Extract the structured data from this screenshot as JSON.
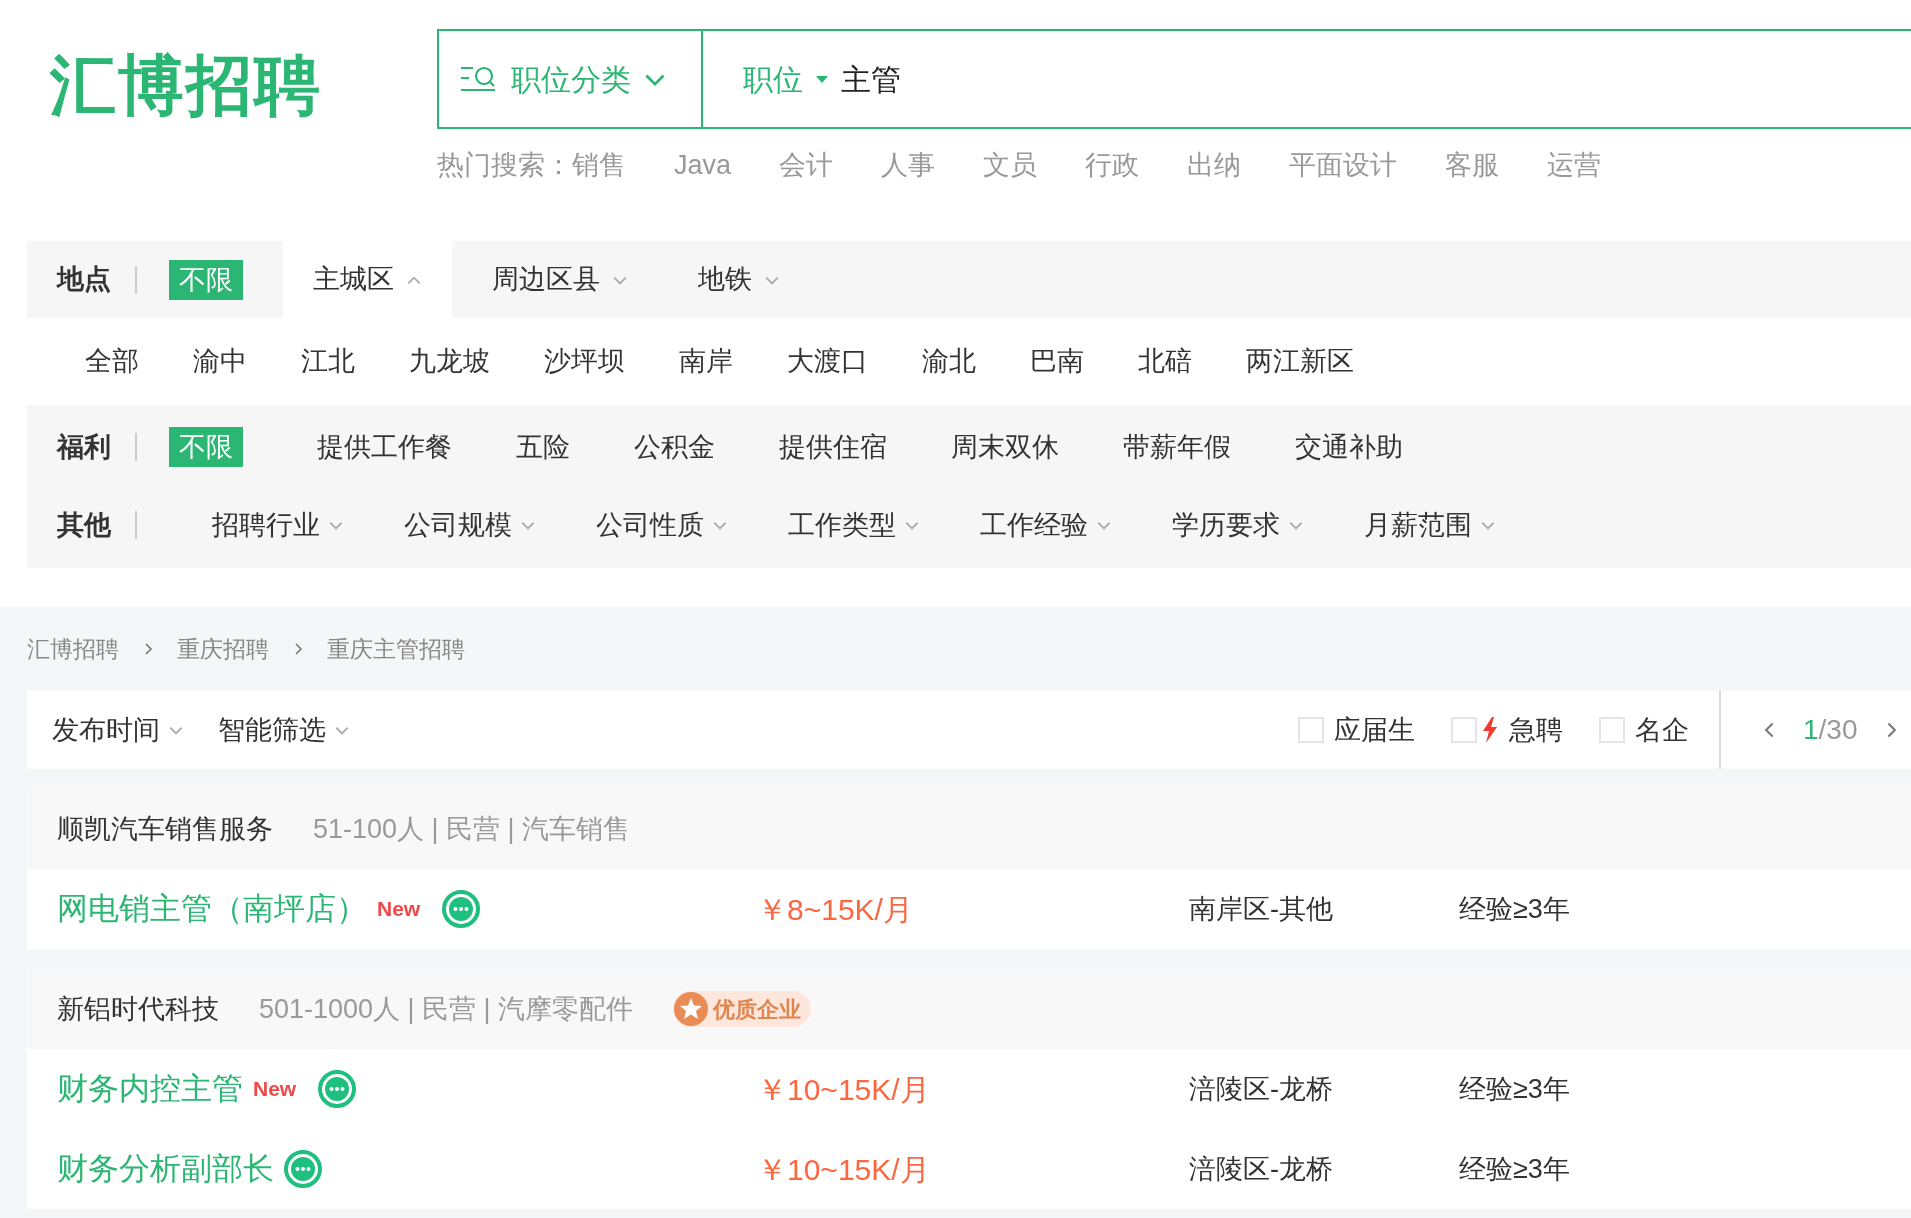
{
  "logo": "汇博招聘",
  "search": {
    "category": "职位分类",
    "field_type": "职位",
    "value": "主管"
  },
  "hot_search": {
    "label": "热门搜索：",
    "terms": [
      "销售",
      "Java",
      "会计",
      "人事",
      "文员",
      "行政",
      "出纳",
      "平面设计",
      "客服",
      "运营"
    ]
  },
  "filters": {
    "location": {
      "label": "地点",
      "options": [
        {
          "label": "不限",
          "selected": true
        }
      ],
      "tabs": [
        {
          "label": "主城区",
          "selected": true
        },
        {
          "label": "周边区县",
          "selected": false
        },
        {
          "label": "地铁",
          "selected": false
        }
      ],
      "districts": [
        {
          "label": "全部",
          "selected": false
        },
        {
          "label": "渝中",
          "selected": false
        },
        {
          "label": "江北",
          "selected": false
        },
        {
          "label": "九龙坡",
          "selected": false
        },
        {
          "label": "沙坪坝",
          "selected": false
        },
        {
          "label": "南岸",
          "selected": false
        },
        {
          "label": "大渡口",
          "selected": false
        },
        {
          "label": "渝北",
          "selected": false
        },
        {
          "label": "巴南",
          "selected": false
        },
        {
          "label": "北碚",
          "selected": false
        },
        {
          "label": "两江新区",
          "selected": false
        }
      ]
    },
    "welfare": {
      "label": "福利",
      "options": [
        {
          "label": "不限",
          "selected": true
        },
        {
          "label": "提供工作餐",
          "selected": false
        },
        {
          "label": "五险",
          "selected": false
        },
        {
          "label": "公积金",
          "selected": false
        },
        {
          "label": "提供住宿",
          "selected": false
        },
        {
          "label": "周末双休",
          "selected": false
        },
        {
          "label": "带薪年假",
          "selected": false
        },
        {
          "label": "交通补助",
          "selected": false
        }
      ]
    },
    "other": {
      "label": "其他",
      "dropdowns": [
        "招聘行业",
        "公司规模",
        "公司性质",
        "工作类型",
        "工作经验",
        "学历要求",
        "月薪范围"
      ]
    }
  },
  "breadcrumb": [
    "汇博招聘",
    "重庆招聘",
    "重庆主管招聘"
  ],
  "toolbar": {
    "sorts": [
      "发布时间",
      "智能筛选"
    ],
    "checks": [
      {
        "label": "应届生",
        "checked": false,
        "kind": "plain"
      },
      {
        "label": "急聘",
        "checked": false,
        "kind": "urgent"
      },
      {
        "label": "名企",
        "checked": false,
        "kind": "plain"
      }
    ],
    "pager": {
      "current": "1",
      "total": "/30"
    }
  },
  "companies": [
    {
      "name": "顺凯汽车销售服务",
      "info": "51-100人 | 民营 | 汽车销售",
      "jobs": [
        {
          "title": "网电销主管（南坪店）",
          "tag": "New",
          "salary": "￥8~15K/月",
          "location": "南岸区-其他",
          "experience": "经验≥3年"
        }
      ]
    },
    {
      "name": "新铝时代科技",
      "info": "501-1000人 | 民营 | 汽摩零配件",
      "badge": "优质企业",
      "jobs": [
        {
          "title": "财务内控主管",
          "tag": "New",
          "salary": "￥10~15K/月",
          "location": "涪陵区-龙桥",
          "experience": "经验≥3年"
        },
        {
          "title": "财务分析副部长",
          "salary": "￥10~15K/月",
          "location": "涪陵区-龙桥",
          "experience": "经验≥3年"
        }
      ]
    }
  ]
}
